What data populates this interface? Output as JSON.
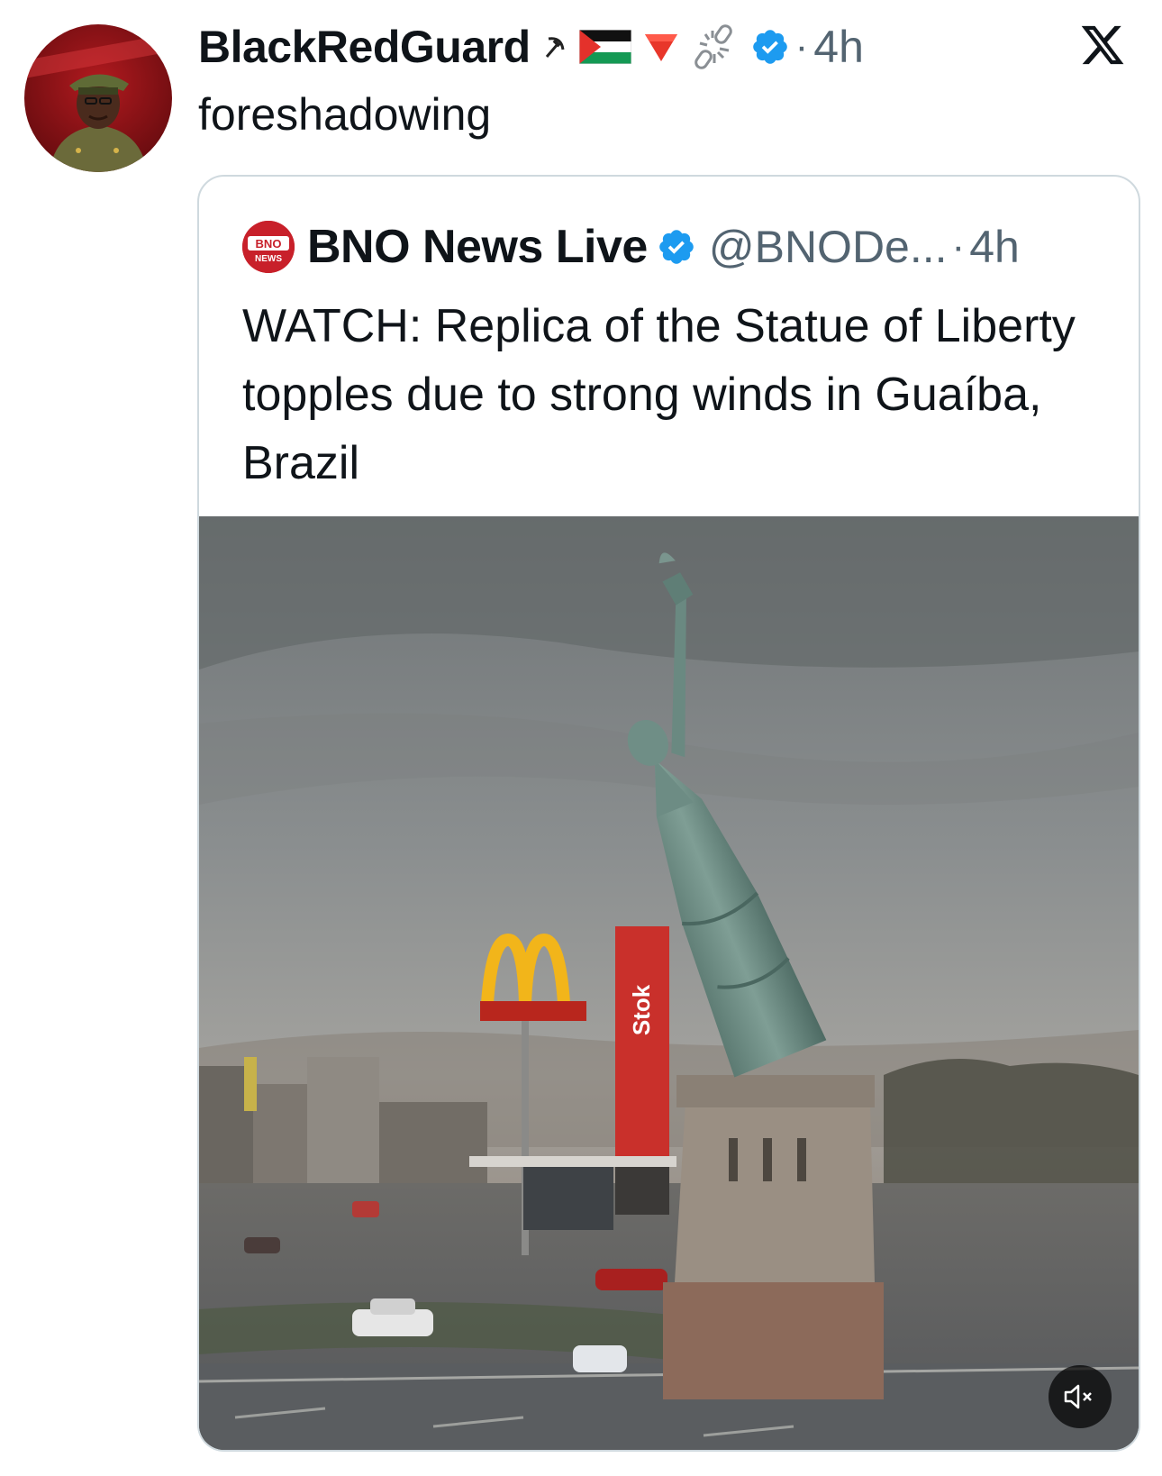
{
  "post": {
    "display_name": "BlackRedGuard",
    "emojis": [
      "hammer-sickle",
      "palestine-flag",
      "red-triangle-down",
      "broken-chain"
    ],
    "verified": true,
    "separator": "·",
    "time": "4h",
    "text": "foreshadowing"
  },
  "quote": {
    "name": "BNO News Live",
    "verified": true,
    "handle": "@BNODe...",
    "separator": "·",
    "time": "4h",
    "logo_text_1": "BNO",
    "logo_text_2": "NEWS",
    "text": "WATCH: Replica of the Statue of Liberty topples due to strong winds in Guaíba, Brazil",
    "media": {
      "type": "video",
      "sign_text": "Stok",
      "muted": true
    }
  },
  "colors": {
    "text_primary": "#0f1419",
    "text_secondary": "#536471",
    "verified_blue": "#1d9bf0",
    "border": "#cfd9de",
    "bno_red": "#c8202a"
  }
}
